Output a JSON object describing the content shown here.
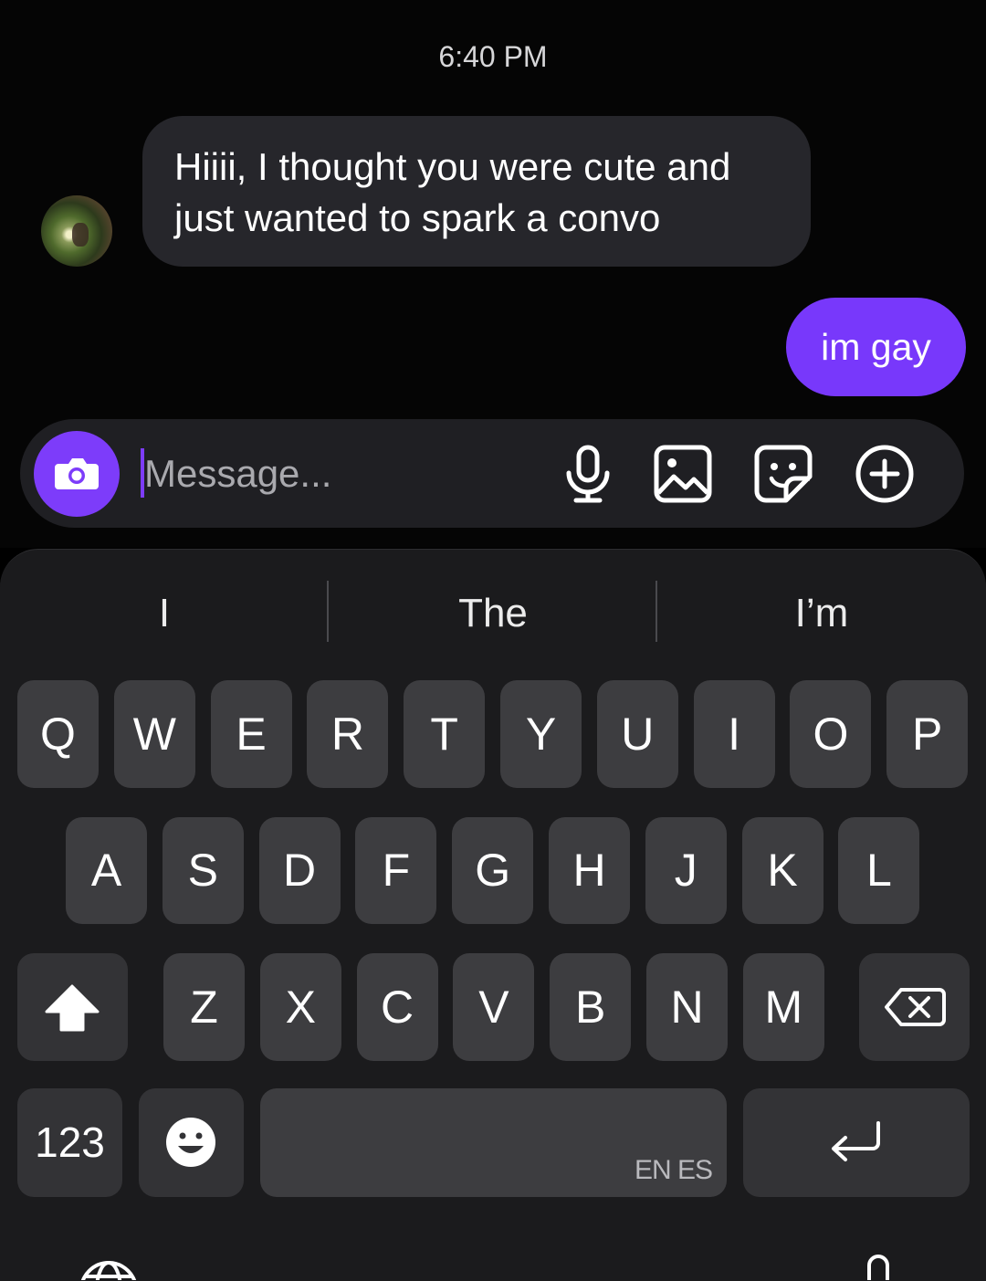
{
  "chat": {
    "timestamp": "6:40 PM",
    "messages": [
      {
        "direction": "incoming",
        "text": "Hiiii, I thought you were cute and just wanted to spark a convo"
      },
      {
        "direction": "outgoing",
        "text": "im gay"
      }
    ]
  },
  "composer": {
    "placeholder": "Message...",
    "icons": [
      "camera-icon",
      "microphone-icon",
      "gallery-icon",
      "sticker-icon",
      "add-icon"
    ]
  },
  "keyboard": {
    "suggestions": [
      "I",
      "The",
      "I’m"
    ],
    "rows": [
      [
        "Q",
        "W",
        "E",
        "R",
        "T",
        "Y",
        "U",
        "I",
        "O",
        "P"
      ],
      [
        "A",
        "S",
        "D",
        "F",
        "G",
        "H",
        "J",
        "K",
        "L"
      ],
      [
        "Z",
        "X",
        "C",
        "V",
        "B",
        "N",
        "M"
      ]
    ],
    "numbers_label": "123",
    "space_languages": "EN ES",
    "icons": [
      "shift-icon",
      "backspace-icon",
      "emoji-icon",
      "return-icon",
      "globe-icon",
      "keyboard-mic-icon"
    ]
  },
  "colors": {
    "accent": "#7838fb",
    "background": "#000000",
    "incoming_bubble": "#26262b",
    "key": "#3d3d40"
  }
}
